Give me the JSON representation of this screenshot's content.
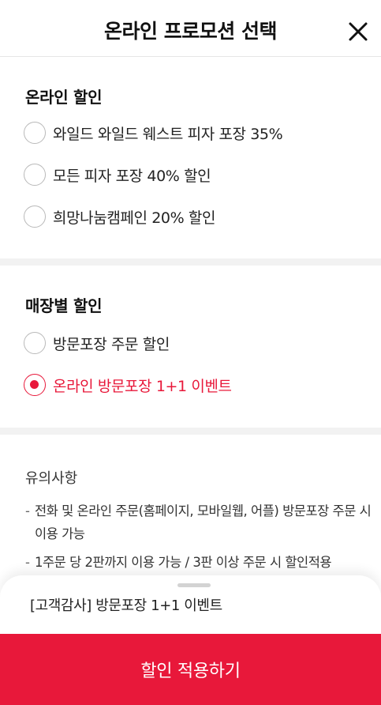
{
  "header": {
    "title": "온라인 프로모션 선택",
    "close_icon": "close-icon"
  },
  "online_discount": {
    "title": "온라인 할인",
    "options": [
      {
        "label": "와일드 와일드 웨스트 피자 포장 35%",
        "selected": false
      },
      {
        "label": "모든 피자 포장 40% 할인",
        "selected": false
      },
      {
        "label": "희망나눔캠페인 20% 할인",
        "selected": false
      }
    ]
  },
  "store_discount": {
    "title": "매장별 할인",
    "options": [
      {
        "label": "방문포장 주문 할인",
        "selected": false
      },
      {
        "label": "온라인 방문포장 1+1 이벤트",
        "selected": true
      }
    ]
  },
  "notice": {
    "title": "유의사항",
    "items": [
      "전화 및 온라인 주문(홈페이지, 모바일웹, 어플) 방문포장 주문 시 이용 가능",
      "1주문 당 2판까지 이용 가능 / 3판 이상 주문 시 할인적용"
    ]
  },
  "bottom_sheet": {
    "selected_summary": "[고객감사] 방문포장 1+1 이벤트",
    "apply_label": "할인 적용하기"
  },
  "colors": {
    "accent": "#e8183a",
    "divider": "#f2f2f2",
    "radio_border": "#b9b9b9"
  }
}
